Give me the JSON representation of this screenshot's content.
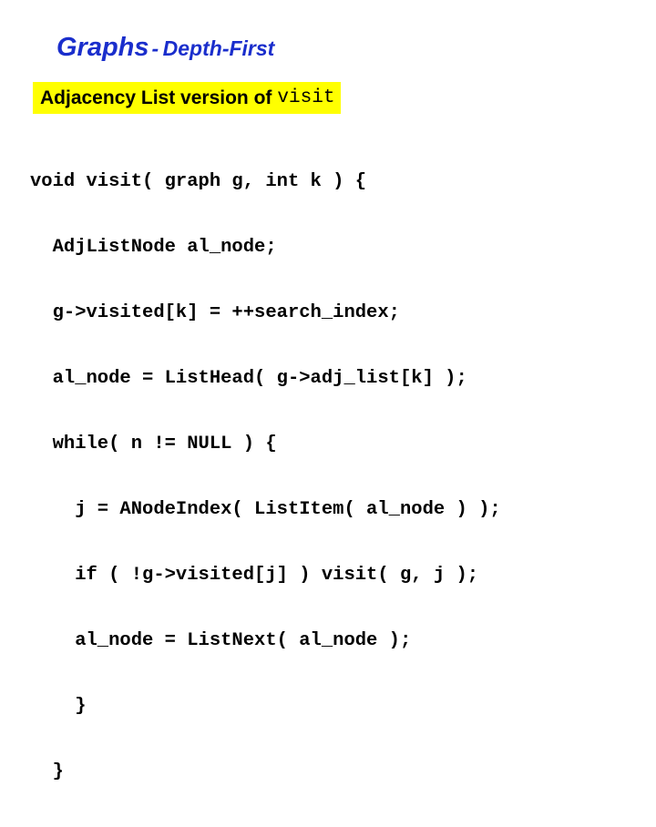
{
  "slide": {
    "background_color": "#ffffff",
    "title": {
      "main": "Graphs",
      "separator": "-",
      "subtitle": "Depth-First",
      "color": "#1a2ecc"
    },
    "subheading": {
      "prefix": "Adjacency List version of",
      "mono_term": "visit",
      "highlight_color": "#ffff00",
      "text_color": "#000000"
    },
    "code": {
      "language": "c",
      "lines": [
        "void visit( graph g, int k ) {",
        "  AdjListNode al_node;",
        "  g->visited[k] = ++search_index;",
        "  al_node = ListHead( g->adj_list[k] );",
        "  while( n != NULL ) {",
        "    j = ANodeIndex( ListItem( al_node ) );",
        "    if ( !g->visited[j] ) visit( g, j );",
        "    al_node = ListNext( al_node );",
        "    }",
        "  }"
      ]
    }
  }
}
